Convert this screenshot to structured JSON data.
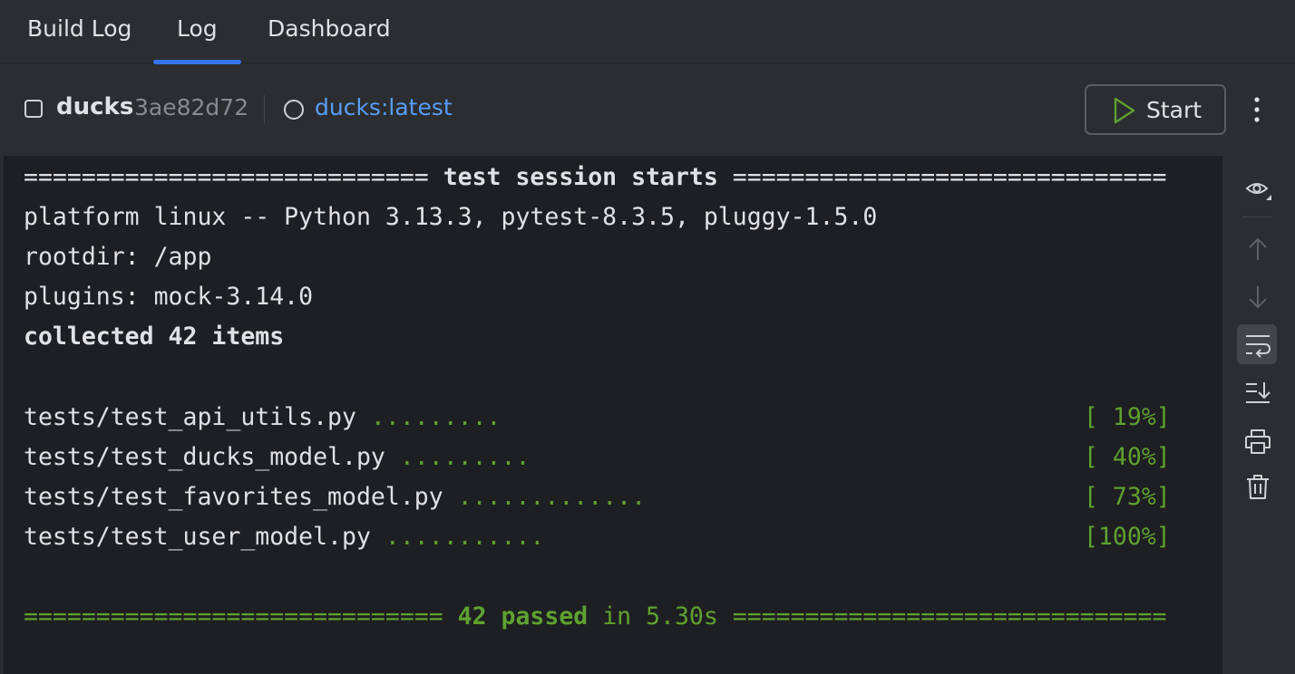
{
  "tabs": [
    {
      "label": "Build Log",
      "active": false
    },
    {
      "label": "Log",
      "active": true
    },
    {
      "label": "Dashboard",
      "active": false
    }
  ],
  "toolbar": {
    "container_name": "ducks",
    "container_hash": "3ae82d72",
    "image_label": "ducks:latest",
    "start_label": "Start"
  },
  "console": {
    "header_left": "============================ ",
    "header_title": "test session starts",
    "header_right": " ==============================",
    "platform": "platform linux -- Python 3.13.3, pytest-8.3.5, pluggy-1.5.0",
    "rootdir": "rootdir: /app",
    "plugins": "plugins: mock-3.14.0",
    "collected": "collected 42 items",
    "tests": [
      {
        "file": "tests/test_api_utils.py",
        "dots": ".........",
        "percent": "[ 19%]"
      },
      {
        "file": "tests/test_ducks_model.py",
        "dots": ".........",
        "percent": "[ 40%]"
      },
      {
        "file": "tests/test_favorites_model.py",
        "dots": ".............",
        "percent": "[ 73%]"
      },
      {
        "file": "tests/test_user_model.py",
        "dots": "...........",
        "percent": "[100%]"
      }
    ],
    "summary_left": "============================= ",
    "summary_passed": "42 passed",
    "summary_time": " in 5.30s ",
    "summary_right": "=============================="
  },
  "colors": {
    "accent": "#3574f0",
    "link": "#589df6",
    "success": "#5fa130",
    "console_bg": "#1e1f22",
    "panel_bg": "#2b2d30"
  },
  "icons": {
    "start": "play-icon",
    "more": "kebab-menu-icon",
    "tools": [
      "eye-icon",
      "arrow-up-icon",
      "arrow-down-icon",
      "soft-wrap-icon",
      "scroll-to-end-icon",
      "print-icon",
      "trash-icon"
    ]
  }
}
